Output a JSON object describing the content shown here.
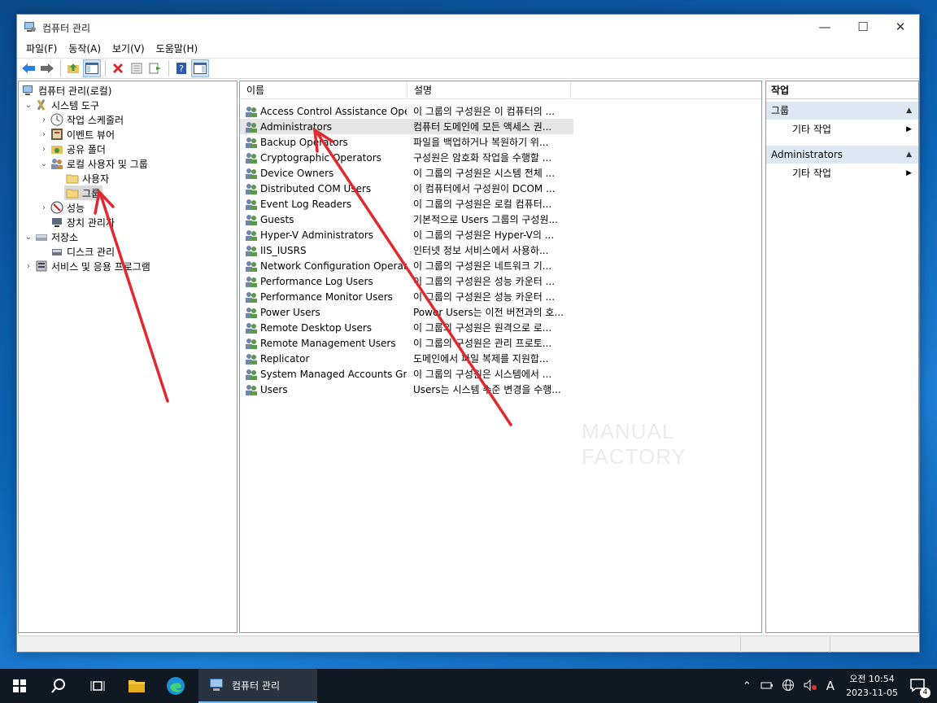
{
  "window": {
    "title": "컴퓨터 관리"
  },
  "menu": [
    "파일(F)",
    "동작(A)",
    "보기(V)",
    "도움말(H)"
  ],
  "tree": {
    "root": "컴퓨터 관리(로컬)",
    "system_tools": "시스템 도구",
    "task_scheduler": "작업 스케줄러",
    "event_viewer": "이벤트 뷰어",
    "shared_folders": "공유 폴더",
    "local_users_groups": "로컬 사용자 및 그룹",
    "users": "사용자",
    "groups": "그룹",
    "performance": "성능",
    "device_manager": "장치 관리자",
    "storage": "저장소",
    "disk_management": "디스크 관리",
    "services_apps": "서비스 및 응용 프로그램"
  },
  "list": {
    "columns": [
      "이름",
      "설명"
    ],
    "rows": [
      {
        "name": "Access Control Assistance Oper...",
        "desc": "이 그룹의 구성원은 이 컴퓨터의 ..."
      },
      {
        "name": "Administrators",
        "desc": "컴퓨터 도메인에 모든 액세스 권..."
      },
      {
        "name": "Backup Operators",
        "desc": "파일을 백업하거나 복원하기 위..."
      },
      {
        "name": "Cryptographic Operators",
        "desc": "구성원은 암호화 작업을 수행할 ..."
      },
      {
        "name": "Device Owners",
        "desc": "이 그룹의 구성원은 시스템 전체 ..."
      },
      {
        "name": "Distributed COM Users",
        "desc": "이 컴퓨터에서 구성원이 DCOM ..."
      },
      {
        "name": "Event Log Readers",
        "desc": "이 그룹의 구성원은 로컬 컴퓨터..."
      },
      {
        "name": "Guests",
        "desc": "기본적으로 Users 그룹의 구성원..."
      },
      {
        "name": "Hyper-V Administrators",
        "desc": "이 그룹의 구성원은 Hyper-V의 ..."
      },
      {
        "name": "IIS_IUSRS",
        "desc": "인터넷 정보 서비스에서 사용하..."
      },
      {
        "name": "Network Configuration Operators",
        "desc": "이 그룹의 구성원은 네트워크 기..."
      },
      {
        "name": "Performance Log Users",
        "desc": "이 그룹의 구성원은 성능 카운터 ..."
      },
      {
        "name": "Performance Monitor Users",
        "desc": "이 그룹의 구성원은 성능 카운터 ..."
      },
      {
        "name": "Power Users",
        "desc": "Power Users는 이전 버전과의 호..."
      },
      {
        "name": "Remote Desktop Users",
        "desc": "이 그룹의 구성원은 원격으로 로..."
      },
      {
        "name": "Remote Management Users",
        "desc": "이 그룹의 구성원은 관리 프로토..."
      },
      {
        "name": "Replicator",
        "desc": "도메인에서 파일 복제를 지원합..."
      },
      {
        "name": "System Managed Accounts Gro...",
        "desc": "이 그룹의 구성원은 시스템에서 ..."
      },
      {
        "name": "Users",
        "desc": "Users는 시스템 수준 변경을 수행..."
      }
    ]
  },
  "actions": {
    "title": "작업",
    "section1": "그룹",
    "section1_item": "기타 작업",
    "section2": "Administrators",
    "section2_item": "기타 작업"
  },
  "watermark": "MANUAL FACTORY",
  "taskbar": {
    "app_label": "컴퓨터 관리",
    "time": "오전 10:54",
    "date": "2023-11-05",
    "ime": "A",
    "notif_count": "4"
  }
}
